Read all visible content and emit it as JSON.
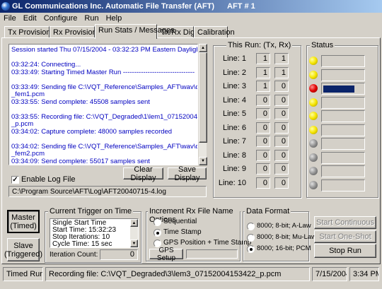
{
  "window": {
    "title": "GL Communications Inc. Automatic File Transfer (AFT)",
    "instance": "AFT # 1"
  },
  "menu": {
    "file": "File",
    "edit": "Edit",
    "configure": "Configure",
    "run": "Run",
    "help": "Help"
  },
  "tabs": [
    "Tx Provisioning",
    "Rx Provisioning",
    "Run Stats / Messages",
    "Tx/Rx Digits",
    "Calibration"
  ],
  "log": {
    "lines": [
      "Session started Thu 07/15/2004 - 03:32:23 PM Eastern Daylight Time",
      "",
      "03:32:24: Connecting...",
      "03:33:49: Starting Timed Master Run --------------------------------",
      "",
      "03:33:49: Sending file C:\\VQT_Reference\\Samples_AFT\\wav\\dtmf_1",
      "_fem1.pcm",
      "03:33:55: Send complete: 45508 samples sent",
      "",
      "03:33:55: Recording file: C:\\VQT_Degraded\\1\\lem1_07152004153355",
      "_p.pcm",
      "03:34:02: Capture complete: 48000 samples recorded",
      "",
      "03:34:02: Sending file C:\\VQT_Reference\\Samples_AFT\\wav\\dtmf_2",
      "_fem2.pcm",
      "03:34:09: Send complete: 55017 samples sent"
    ]
  },
  "log_controls": {
    "clear": "Clear Display",
    "save": "Save Display",
    "enable_label": "Enable Log File",
    "enable_checked": true,
    "log_path": "C:\\Program Source\\AFT\\Log\\AFT20040715-4.log"
  },
  "this_run": {
    "title": "This Run: (Tx, Rx)",
    "lines": [
      {
        "label": "Line: 1",
        "tx": "1",
        "rx": "1"
      },
      {
        "label": "Line: 2",
        "tx": "1",
        "rx": "1"
      },
      {
        "label": "Line: 3",
        "tx": "1",
        "rx": "0"
      },
      {
        "label": "Line: 4",
        "tx": "0",
        "rx": "0"
      },
      {
        "label": "Line: 5",
        "tx": "0",
        "rx": "0"
      },
      {
        "label": "Line: 6",
        "tx": "0",
        "rx": "0"
      },
      {
        "label": "Line: 7",
        "tx": "0",
        "rx": "0"
      },
      {
        "label": "Line: 8",
        "tx": "0",
        "rx": "0"
      },
      {
        "label": "Line: 9",
        "tx": "0",
        "rx": "0"
      },
      {
        "label": "Line: 10",
        "tx": "0",
        "rx": "0"
      }
    ]
  },
  "status": {
    "title": "Status",
    "leds": [
      "yellow",
      "yellow",
      "red",
      "yellow",
      "yellow",
      "yellow",
      "gray",
      "gray",
      "gray",
      "gray"
    ],
    "colors": {
      "yellow": "#f5e400",
      "red": "#e00000",
      "gray": "#909090",
      "active_bar": "#0a246a"
    }
  },
  "mode": {
    "master": "Master\n(Timed)",
    "slave": "Slave\n(Triggered)"
  },
  "trigger": {
    "title": "Current Trigger on Time",
    "lines": [
      "Single Start Time",
      "Start Time: 15:32:23",
      "Stop Iterations: 10",
      "Cycle Time: 15 sec"
    ],
    "iteration_label": "Iteration Count:",
    "iteration_value": "0"
  },
  "increment": {
    "title": "Increment Rx File Name Options",
    "options": [
      "Sequential",
      "Time Stamp",
      "GPS Position + Time Stamp"
    ],
    "selected": 1,
    "gps_setup": "GPS Setup"
  },
  "data_format": {
    "title": "Data Format",
    "options": [
      "8000; 8-bit; A-Law",
      "8000; 8-bit; Mu-Law",
      "8000; 16-bit; PCM"
    ],
    "selected": 2
  },
  "run_buttons": {
    "start_continuous": "Start Continuous",
    "start_oneshot": "Start One-Shot",
    "stop_run": "Stop Run"
  },
  "statusbar": {
    "mode": "Timed Run",
    "message": "Recording file: C:\\VQT_Degraded\\3\\lem3_07152004153422_p.pcm",
    "date": "7/15/2004",
    "time": "3:34 PM"
  }
}
